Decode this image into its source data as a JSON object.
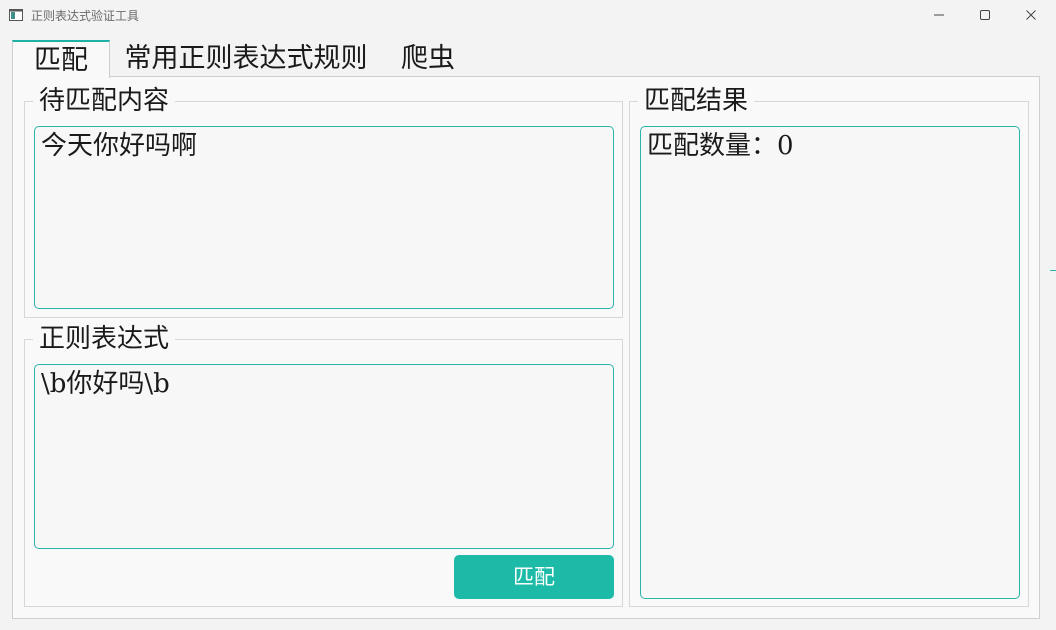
{
  "window": {
    "title": "正则表达式验证工具",
    "icon": "app-window-icon",
    "controls": [
      "minimize-icon",
      "maximize-icon",
      "close-icon"
    ]
  },
  "tabs": [
    {
      "label": "匹配",
      "active": true
    },
    {
      "label": "常用正则表达式规则",
      "active": false
    },
    {
      "label": "爬虫",
      "active": false
    }
  ],
  "match_tab": {
    "content_group": {
      "title": "待匹配内容",
      "value": "今天你好吗啊"
    },
    "regex_group": {
      "title": "正则表达式",
      "value": "\\b你好吗\\b"
    },
    "match_button": {
      "label": "匹配"
    },
    "result_group": {
      "title": "匹配结果",
      "value": "匹配数量：0"
    }
  },
  "colors": {
    "accent": "#1cbaa7",
    "border_accent": "#2bb5aa"
  }
}
